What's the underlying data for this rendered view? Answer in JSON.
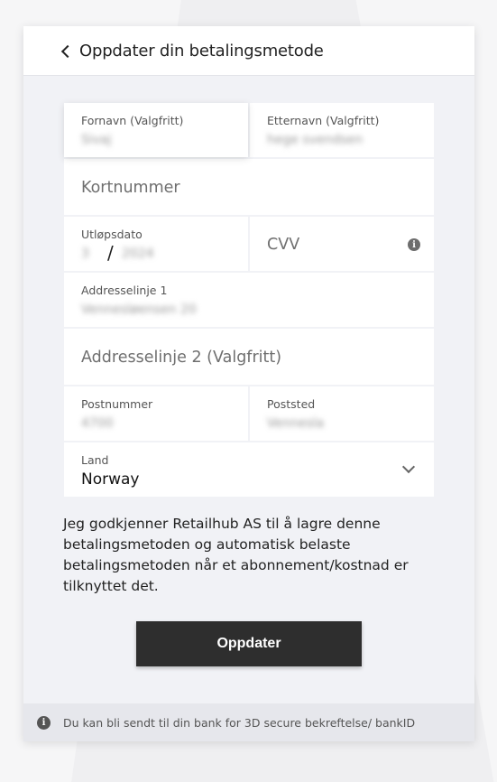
{
  "header": {
    "title": "Oppdater din betalingsmetode"
  },
  "form": {
    "first_name": {
      "label": "Fornavn (Valgfritt)",
      "value": "Sivaj"
    },
    "last_name": {
      "label": "Etternavn (Valgfritt)",
      "value": "hege svendsen"
    },
    "card_number": {
      "placeholder": "Kortnummer"
    },
    "expiry": {
      "label": "Utløpsdato",
      "month": "3",
      "separator": "/",
      "year": "2024"
    },
    "cvv": {
      "placeholder": "CVV",
      "info_icon": "i"
    },
    "address1": {
      "label": "Addresselinje 1",
      "value": "Vennesløensen 20"
    },
    "address2": {
      "placeholder": "Addresselinje 2 (Valgfritt)"
    },
    "postal_code": {
      "label": "Postnummer",
      "value": "4700"
    },
    "city": {
      "label": "Poststed",
      "value": "Vennesla"
    },
    "country": {
      "label": "Land",
      "value": "Norway"
    }
  },
  "consent_text": "Jeg godkjenner Retailhub AS til å lagre denne betalingsmetoden og automatisk belaste betalingsmetoden når et abonnement/kostnad er tilknyttet det.",
  "submit_label": "Oppdater",
  "footer": {
    "icon": "i",
    "text": "Du kan bli sendt til din bank for 3D secure bekreftelse/ bankID"
  }
}
